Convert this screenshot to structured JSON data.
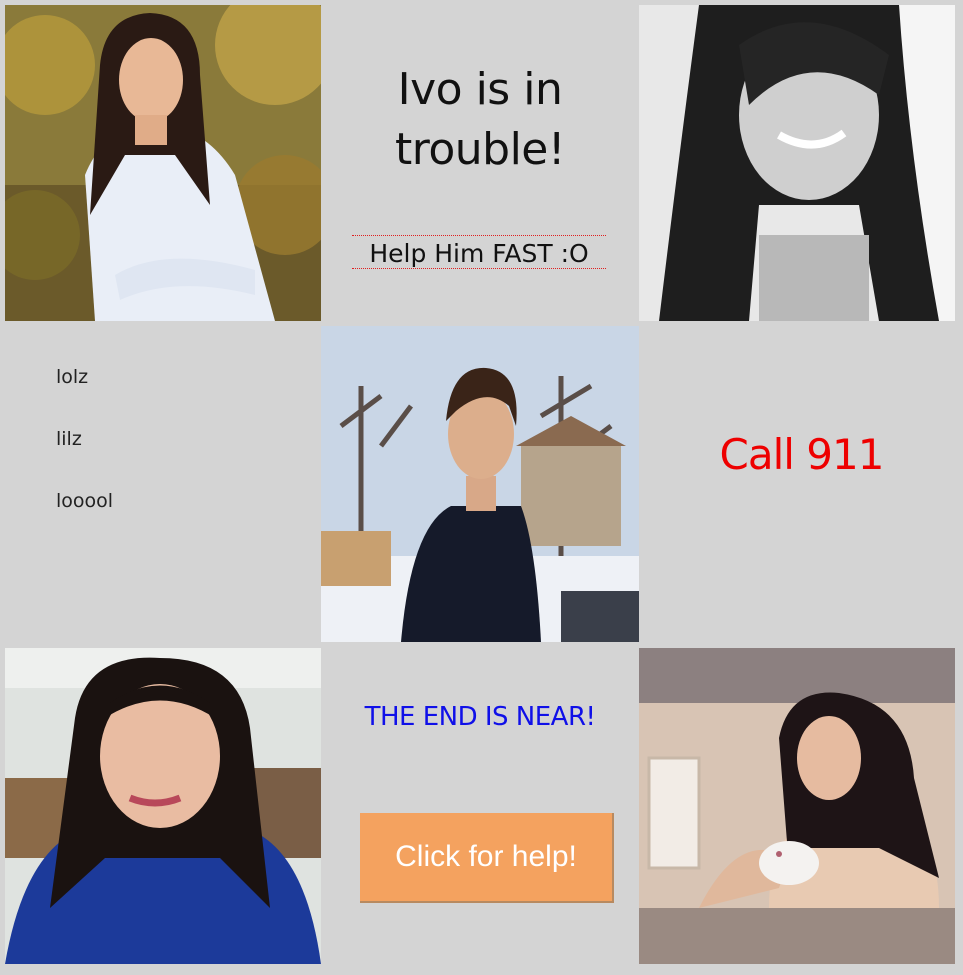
{
  "header": {
    "title_line1": "Ivo is in",
    "title_line2": "trouble!",
    "help_link": "Help Him FAST :O"
  },
  "list": {
    "items": [
      "lolz",
      "lilz",
      "looool"
    ]
  },
  "call": {
    "text": "Call 911",
    "color": "#ee0000"
  },
  "bottom": {
    "end_text": "THE END IS NEAR!",
    "end_color": "#1010e8",
    "button_label": "Click for help!",
    "button_color": "#f4a25f"
  },
  "photos": [
    "portrait-woman-autumn-photo",
    "portrait-woman-bw-photo",
    "portrait-man-winter-photo",
    "portrait-woman-office-photo",
    "portrait-woman-with-pet-photo"
  ]
}
